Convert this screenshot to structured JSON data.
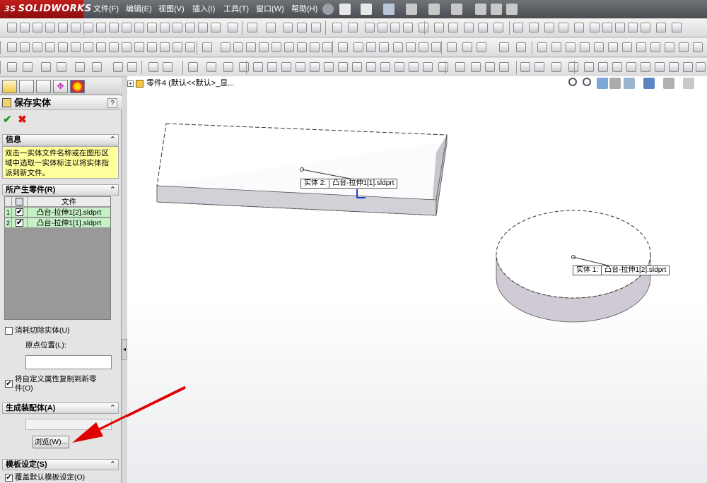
{
  "app": {
    "logo_text": "SOLIDWORKS",
    "logo_ds": "3S",
    "menus": [
      "文件(F)",
      "编辑(E)",
      "视图(V)",
      "插入(I)",
      "工具(T)",
      "窗口(W)",
      "帮助(H)"
    ]
  },
  "feature_tree": {
    "flyout_text": "零件4  (默认<<默认>_显..."
  },
  "property_manager": {
    "title": "保存实体",
    "help": "?",
    "ok_symbol": "✔",
    "cancel_symbol": "✖",
    "info_header": "信息",
    "info_text": "双击一实体文件名称或在图形区域中选取一实体标注以将实体指派到新文件。",
    "parts_header": "所产生零件(R)",
    "parts_table": {
      "file_column": "文件",
      "rows": [
        {
          "num": "1",
          "checked": "✔",
          "file": "凸台-拉伸1[2].sldprt"
        },
        {
          "num": "2",
          "checked": "✔",
          "file": "凸台-拉伸1[1].sldprt"
        }
      ]
    },
    "consume_cut": {
      "label": "消耗切除实体(U)",
      "checked": ""
    },
    "origin_label": "原点位置(L):",
    "origin_value": "",
    "copy_props": {
      "label_line1": "将自定义属性复制到新零",
      "label_line2": "件(O)",
      "checked": "✔"
    },
    "assembly_header": "生成装配体(A)",
    "assembly_value": "",
    "browse_button": "浏览(W)...",
    "template_header": "模板设定(S)",
    "override_template": {
      "label": "覆盖默认模板设定(O)",
      "checked": "✔"
    },
    "collapse_symbol": "⌃"
  },
  "viewport": {
    "callouts": [
      {
        "label": "实体 2:",
        "name": "凸台-拉伸1[1].sldprt"
      },
      {
        "label": "实体 1:",
        "name": "凸台-拉伸1[2].sldprt"
      }
    ]
  },
  "colors": {
    "accent_red": "#e00000",
    "body_side": "#c9c5cd",
    "info_yellow": "#ffff9c",
    "grid_green": "#c6f0c6"
  }
}
